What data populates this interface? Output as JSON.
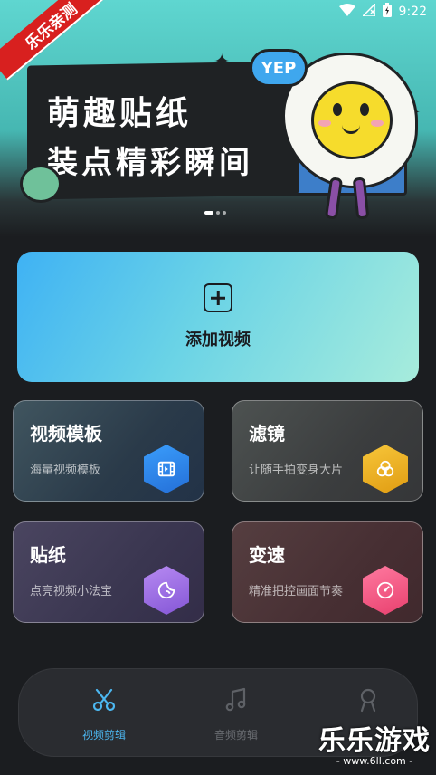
{
  "status_bar": {
    "time": "9:22"
  },
  "watermark": {
    "ribbon": "乐乐亲测",
    "brand": "乐乐游戏",
    "url": "- www.6ll.com -"
  },
  "banner": {
    "title_line1": "萌趣贴纸",
    "title_line2": "装点精彩瞬间",
    "bubble": "YEP",
    "page_indicator": {
      "count": 3,
      "active": 1
    }
  },
  "add_video": {
    "label": "添加视频",
    "icon": "plus-square-icon"
  },
  "features": [
    {
      "title": "视频模板",
      "subtitle": "海量视频模板",
      "icon": "film-icon",
      "color": "#2f86ea"
    },
    {
      "title": "滤镜",
      "subtitle": "让随手拍变身大片",
      "icon": "filter-circles-icon",
      "color": "#f0b024"
    },
    {
      "title": "贴纸",
      "subtitle": "点亮视频小法宝",
      "icon": "sticker-icon",
      "color": "#9c6ee6"
    },
    {
      "title": "变速",
      "subtitle": "精准把控画面节奏",
      "icon": "speedometer-icon",
      "color": "#f25b85"
    }
  ],
  "bottom_nav": {
    "items": [
      {
        "label": "视频剪辑",
        "icon": "scissors-icon",
        "active": true
      },
      {
        "label": "音频剪辑",
        "icon": "music-note-icon",
        "active": false
      },
      {
        "label": "",
        "icon": "user-icon",
        "active": false
      }
    ],
    "active_color": "#4cb7f0"
  }
}
